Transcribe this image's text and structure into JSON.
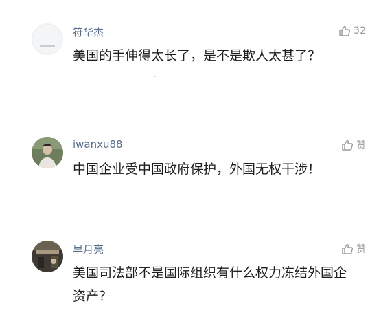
{
  "comments": [
    {
      "username": "符华杰",
      "like_label": "32",
      "text": "美国的手伸得太长了，是不是欺人太甚了？"
    },
    {
      "username": "iwanxu88",
      "like_label": "赞",
      "text": "中国企业受中国政府保护，外国无权干涉！"
    },
    {
      "username": "早月亮",
      "like_label": "赞",
      "text": "美国司法部不是国际组织有什么权力冻结外国企资产？"
    }
  ],
  "colors": {
    "username": "#5a6f8c",
    "like": "#9a9a9a",
    "text": "#1f1f1f"
  },
  "icons": [
    "avatar",
    "thumbs-up-icon"
  ]
}
